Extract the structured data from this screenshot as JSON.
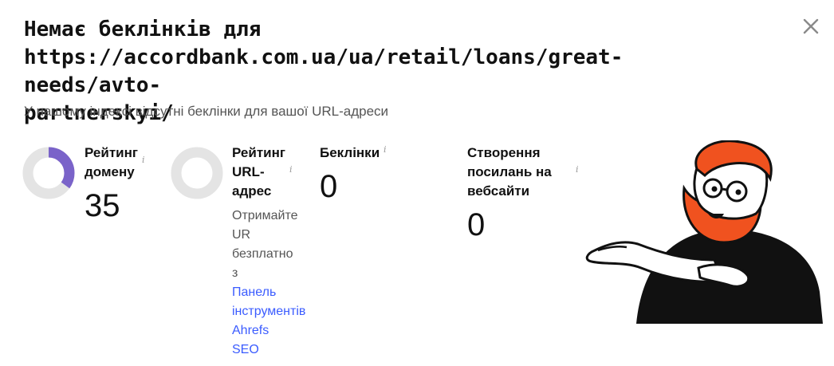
{
  "dialog": {
    "title_line1": "Немає беклінків для",
    "title_line2": "https://accordbank.com.ua/ua/retail/loans/great-needs/avto-",
    "title_line3": "partnerskyi/",
    "subtitle": "У нашому індексі відсутні беклінки для вашої URL-адреси"
  },
  "metrics": {
    "domain_rating": {
      "label_line1": "Рейтинг",
      "label_line2": "домену",
      "value": "35",
      "fraction": 0.35,
      "color": "#7a63c9",
      "track": "#e4e4e4"
    },
    "url_rating": {
      "label_line1": "Рейтинг",
      "label_line2": "URL-",
      "label_line3": "адрес",
      "track": "#e4e4e4"
    },
    "backlinks": {
      "label": "Беклінки",
      "value": "0"
    },
    "linking_websites": {
      "label_line1": "Створення",
      "label_line2": "посилань на",
      "label_line3": "вебсайти",
      "value": "0"
    },
    "info_glyph": "i"
  },
  "promo": {
    "line1": "Отримайте",
    "line2": "UR",
    "line3": "безплатно",
    "line4": "з",
    "link_line1": "Панель",
    "link_line2": "інструментів",
    "link_line3": "Ahrefs",
    "link_line4": "SEO"
  },
  "icons": {
    "close": "close-icon",
    "illustration": "bearded-man-illustration"
  }
}
